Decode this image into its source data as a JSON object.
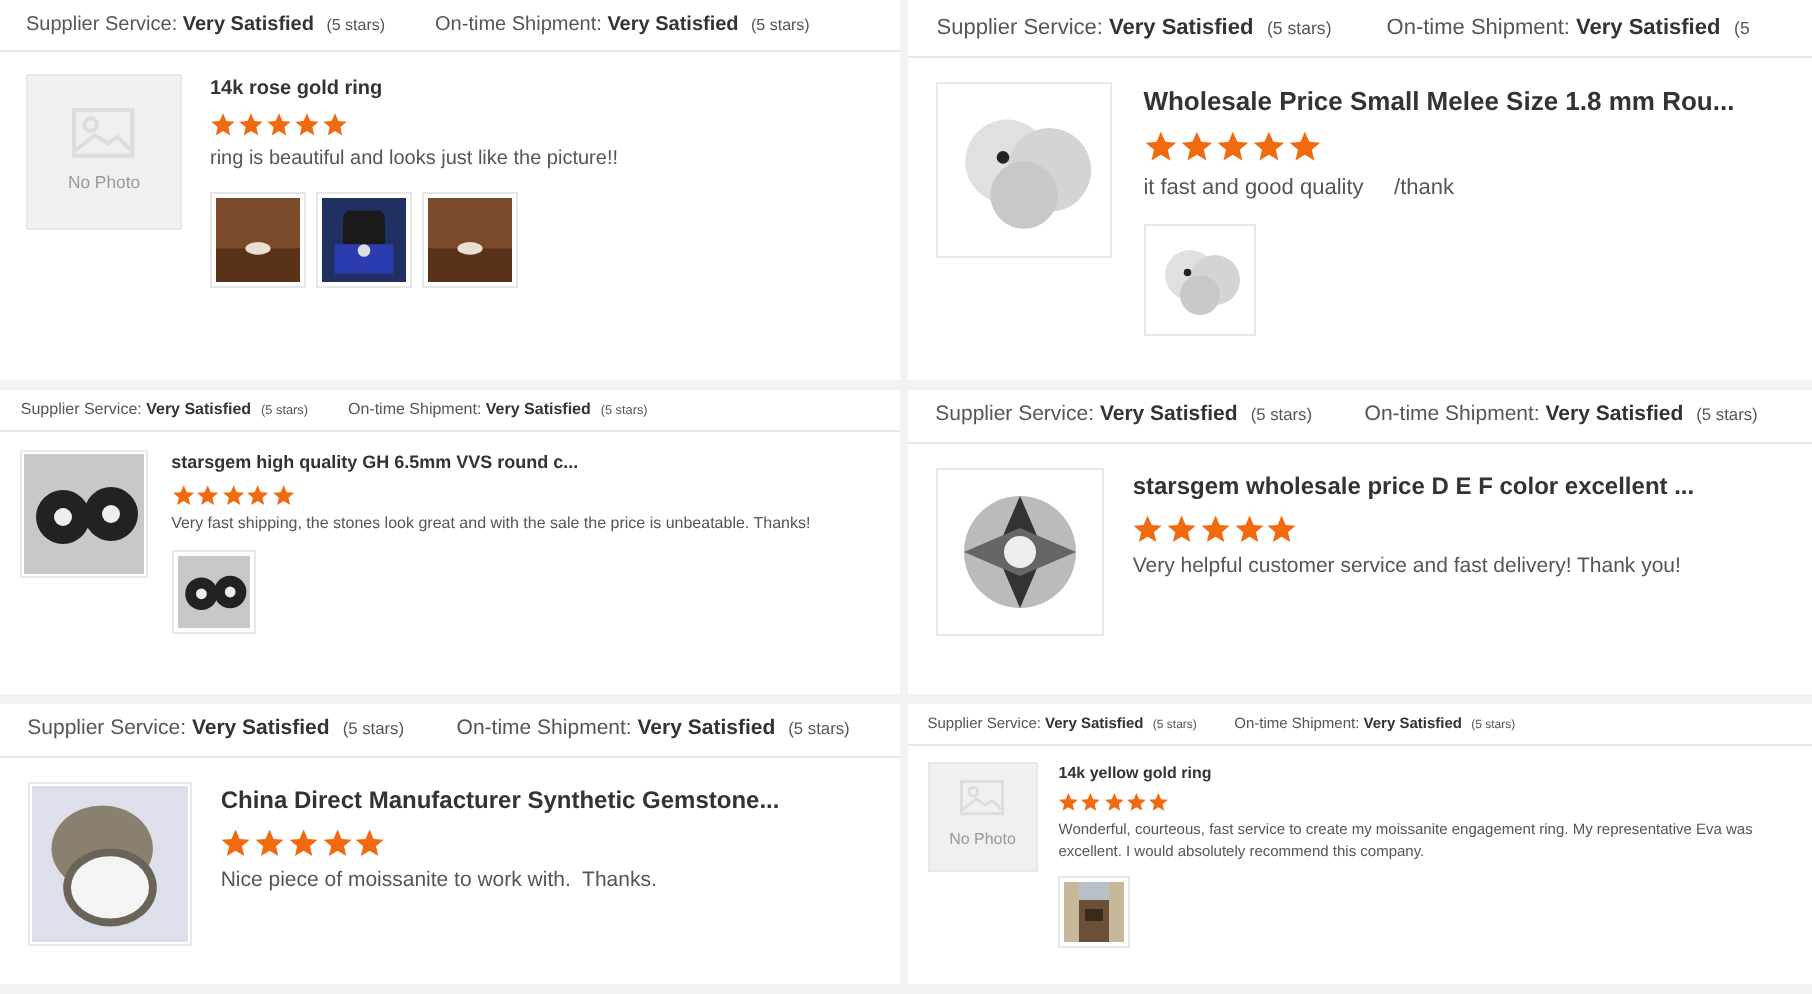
{
  "left_column": [
    {
      "supplier_service": {
        "label": "Supplier Service:",
        "rating": "Very Satisfied",
        "stars_text": "(5 stars)"
      },
      "shipment": {
        "label": "On-time Shipment:",
        "rating": "Very Satisfied",
        "stars_text": "(5 stars)"
      },
      "photo": {
        "kind": "placeholder",
        "label": "No Photo"
      },
      "title": "14k rose gold ring",
      "stars": 5,
      "comment": "ring is beautiful and looks just like the picture!!",
      "attachments": [
        {
          "kind": "picture"
        },
        {
          "kind": "picture"
        },
        {
          "kind": "picture"
        }
      ]
    },
    {
      "supplier_service": {
        "label": "Supplier Service:",
        "rating": "Very Satisfied",
        "stars_text": "(5 stars)"
      },
      "shipment": {
        "label": "On-time Shipment:",
        "rating": "Very Satisfied",
        "stars_text": "(5 stars)"
      },
      "photo": {
        "kind": "picture"
      },
      "title": "starsgem high quality GH 6.5mm VVS round c...",
      "stars": 5,
      "comment": "Very fast shipping, the stones look great and with the sale the price is unbeatable. Thanks!",
      "attachments": [
        {
          "kind": "picture"
        }
      ]
    },
    {
      "supplier_service": {
        "label": "Supplier Service:",
        "rating": "Very Satisfied",
        "stars_text": "(5 stars)"
      },
      "shipment": {
        "label": "On-time Shipment:",
        "rating": "Very Satisfied",
        "stars_text": "(5 stars)"
      },
      "photo": {
        "kind": "picture"
      },
      "title": "China Direct Manufacturer Synthetic Gemstone...",
      "stars": 5,
      "comment": "Nice piece of moissanite to work with.  Thanks."
    }
  ],
  "right_column": [
    {
      "supplier_service": {
        "label": "Supplier Service:",
        "rating": "Very Satisfied",
        "stars_text": "(5 stars)"
      },
      "shipment": {
        "label": "On-time Shipment:",
        "rating": "Very Satisfied",
        "stars_text": "(5"
      },
      "photo": {
        "kind": "picture"
      },
      "title": "Wholesale Price Small Melee Size 1.8 mm Rou...",
      "stars": 5,
      "comment": "it fast and good quality     /thank",
      "attachments": [
        {
          "kind": "picture"
        }
      ]
    },
    {
      "supplier_service": {
        "label": "Supplier Service:",
        "rating": "Very Satisfied",
        "stars_text": "(5 stars)"
      },
      "shipment": {
        "label": "On-time Shipment:",
        "rating": "Very Satisfied",
        "stars_text": "(5 stars)"
      },
      "photo": {
        "kind": "picture"
      },
      "title": "starsgem wholesale price D E F color excellent ...",
      "stars": 5,
      "comment": "Very helpful customer service and fast delivery! Thank you!"
    },
    {
      "supplier_service": {
        "label": "Supplier Service:",
        "rating": "Very Satisfied",
        "stars_text": "(5 stars)"
      },
      "shipment": {
        "label": "On-time Shipment:",
        "rating": "Very Satisfied",
        "stars_text": "(5 stars)"
      },
      "photo": {
        "kind": "placeholder",
        "label": "No Photo"
      },
      "title": "14k yellow gold ring",
      "stars": 5,
      "comment": "Wonderful, courteous, fast service to create my moissanite engagement ring. My representative Eva was excellent. I would absolutely recommend this company.",
      "attachments": [
        {
          "kind": "picture"
        }
      ]
    }
  ]
}
